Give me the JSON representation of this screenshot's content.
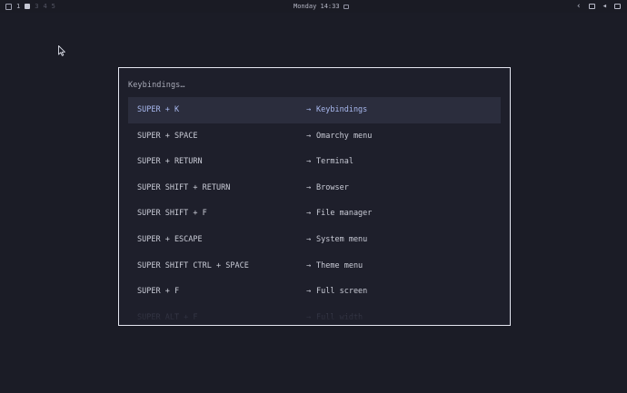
{
  "topbar": {
    "workspace_active": "1",
    "workspace_others": [
      "3",
      "4",
      "5"
    ],
    "clock": "Monday 14:33",
    "icons": [
      "chevron-left-icon",
      "window-icon",
      "speaker-icon",
      "monitor-icon"
    ]
  },
  "launcher": {
    "prompt": "Keybindings…",
    "arrow": "→",
    "items": [
      {
        "key": "SUPER + K",
        "action": "Keybindings"
      },
      {
        "key": "SUPER + SPACE",
        "action": "Omarchy menu"
      },
      {
        "key": "SUPER + RETURN",
        "action": "Terminal"
      },
      {
        "key": "SUPER SHIFT + RETURN",
        "action": "Browser"
      },
      {
        "key": "SUPER SHIFT + F",
        "action": "File manager"
      },
      {
        "key": "SUPER + ESCAPE",
        "action": "System menu"
      },
      {
        "key": "SUPER SHIFT CTRL + SPACE",
        "action": "Theme menu"
      },
      {
        "key": "SUPER + F",
        "action": "Full screen"
      },
      {
        "key": "SUPER ALT + F",
        "action": "Full width"
      }
    ],
    "selected_index": 0
  },
  "colors": {
    "background": "#1b1c26",
    "accent": "#a8b8ee",
    "border": "#e4e6f0"
  }
}
